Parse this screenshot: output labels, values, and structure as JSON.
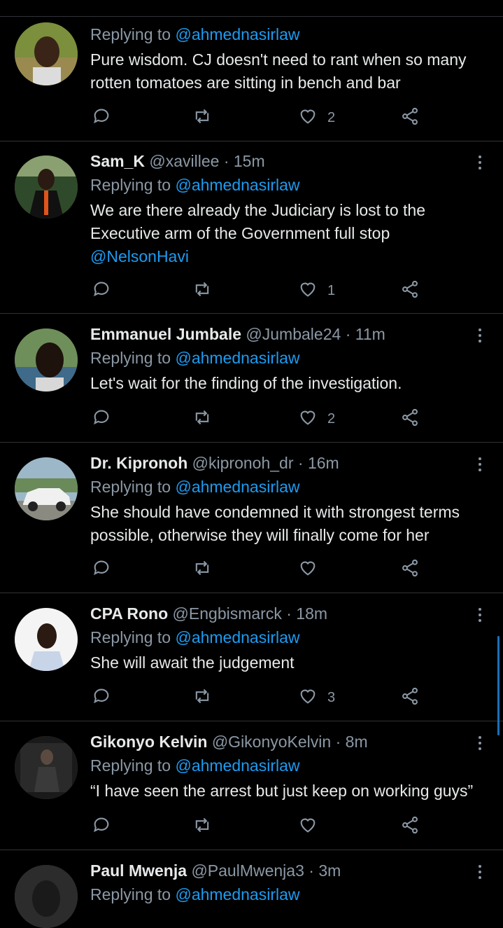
{
  "tweets": [
    {
      "name": "",
      "handle": "",
      "time": "",
      "replying_label": "Replying to",
      "replying_to": "@ahmednasirlaw",
      "text": "Pure wisdom. CJ doesn't need to rant when so many rotten tomatoes are sitting in bench and bar",
      "text_mention": "",
      "likes": "2",
      "avatar": "man-smiling-green-background"
    },
    {
      "name": "Sam_K",
      "handle": "@xavillee",
      "time": "15m",
      "replying_label": "Replying to",
      "replying_to": "@ahmednasirlaw",
      "text": "We are there already the Judiciary is lost to the Executive arm of the Government full stop",
      "text_mention": "@NelsonHavi",
      "likes": "1",
      "avatar": "man-in-suit-orange-tie"
    },
    {
      "name": "Emmanuel Jumbale",
      "handle": "@Jumbale24",
      "time": "11m",
      "replying_label": "Replying to",
      "replying_to": "@ahmednasirlaw",
      "text": "Let's wait for the finding of the investigation.",
      "text_mention": "",
      "likes": "2",
      "avatar": "man-selfie-outdoors"
    },
    {
      "name": "Dr. Kipronoh",
      "handle": "@kipronoh_dr",
      "time": "16m",
      "replying_label": "Replying to",
      "replying_to": "@ahmednasirlaw",
      "text": "She should have condemned it with strongest terms possible, otherwise they will finally come for her",
      "text_mention": "",
      "likes": "",
      "avatar": "white-suv-car"
    },
    {
      "name": "CPA Rono",
      "handle": "@Engbismarck",
      "time": "18m",
      "replying_label": "Replying to",
      "replying_to": "@ahmednasirlaw",
      "text": "She will await the judgement",
      "text_mention": "",
      "likes": "3",
      "avatar": "man-white-shirt-white-background"
    },
    {
      "name": "Gikonyo Kelvin",
      "handle": "@GikonyoKelvin",
      "time": "8m",
      "replying_label": "Replying to",
      "replying_to": "@ahmednasirlaw",
      "text": "“I have seen the arrest but just keep on working guys”",
      "text_mention": "",
      "likes": "",
      "avatar": "man-seated-dark-room"
    },
    {
      "name": "Paul Mwenja",
      "handle": "@PaulMwenja3",
      "time": "3m",
      "replying_label": "Replying to",
      "replying_to": "@ahmednasirlaw",
      "text": "",
      "text_mention": "",
      "likes": "",
      "avatar": "man-dark-grey"
    }
  ],
  "colors": {
    "background": "#000000",
    "link": "#1d9bf0",
    "muted": "#8b98a5",
    "divider": "#2f3336"
  },
  "icons": {
    "reply": "reply-icon",
    "retweet": "retweet-icon",
    "like": "heart-icon",
    "share": "share-icon",
    "more": "more-vertical-icon"
  }
}
